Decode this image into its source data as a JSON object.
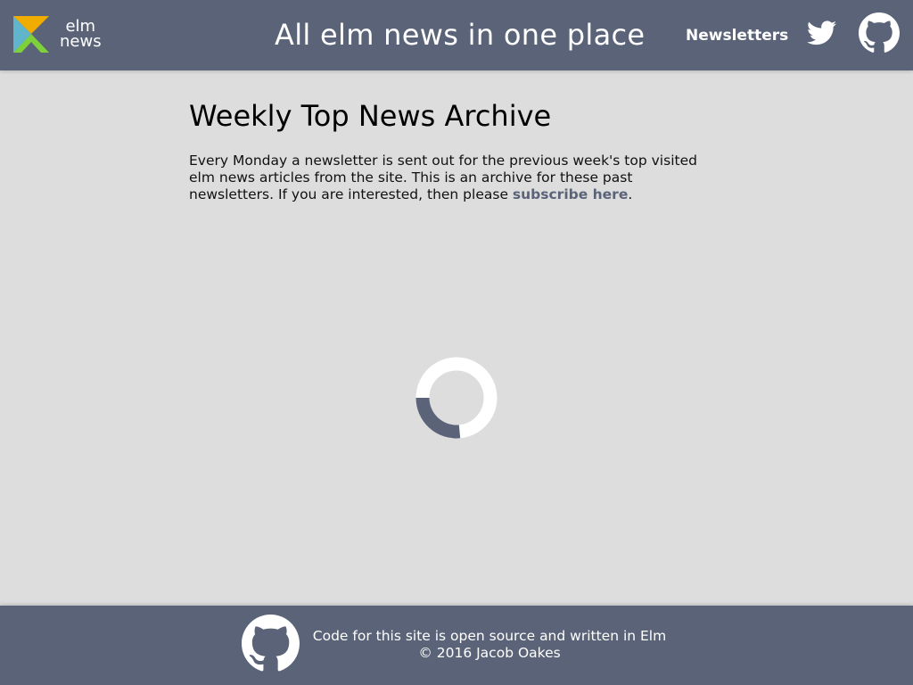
{
  "header": {
    "brand": {
      "line1": "elm",
      "line2": "news"
    },
    "tagline": "All elm news in one place",
    "nav": {
      "newsletters_label": "Newsletters",
      "twitter_icon": "twitter-bird-icon",
      "github_icon": "github-octocat-icon"
    }
  },
  "main": {
    "title": "Weekly Top News Archive",
    "intro": {
      "text": "Every Monday a newsletter is sent out for the previous week's top visited elm news articles from the site. This is an archive for these past newsletters. If you are interested, then please ",
      "link_label": "subscribe here",
      "suffix": "."
    },
    "loading_indicator_icon": "loading-spinner-icon"
  },
  "footer": {
    "github_icon": "github-octocat-icon",
    "line1": "Code for this site is open source and written in Elm",
    "line2": "© 2016 Jacob Oakes"
  },
  "colors": {
    "header_bg": "#5a6378",
    "page_bg": "#dddddd",
    "link": "#5a6378",
    "logo_orange": "#f0ad00",
    "logo_green": "#7fd13b",
    "logo_blue": "#60b5cc",
    "logo_slate": "#5a6378"
  }
}
